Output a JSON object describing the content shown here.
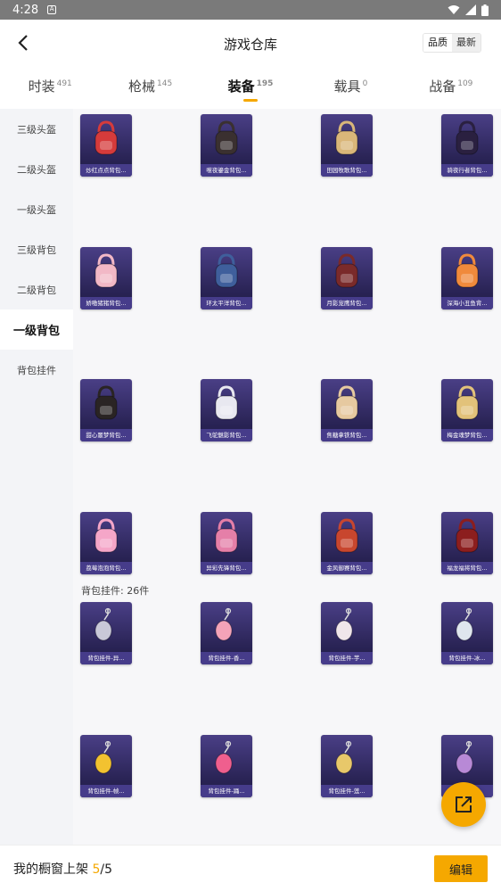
{
  "status_bar": {
    "time": "4:28",
    "notif_glyph": "A"
  },
  "header": {
    "title": "游戏仓库",
    "sort_options": [
      "品质",
      "最新"
    ]
  },
  "tabs": [
    {
      "label": "时装",
      "count": "491"
    },
    {
      "label": "枪械",
      "count": "145"
    },
    {
      "label": "装备",
      "count": "195"
    },
    {
      "label": "载具",
      "count": "0"
    },
    {
      "label": "战备",
      "count": "109"
    }
  ],
  "sidebar": [
    "三级头盔",
    "二级头盔",
    "一级头盔",
    "三级背包",
    "二级背包",
    "一级背包",
    "背包挂件"
  ],
  "backpacks": [
    {
      "name": "炒红点点背包...",
      "icon": "backpack-red-icon",
      "color": "#d63b3b"
    },
    {
      "name": "噬夜鎏金背包...",
      "icon": "backpack-black-gold-icon",
      "color": "#3a3030"
    },
    {
      "name": "田园牧歌背包...",
      "icon": "backpack-basket-icon",
      "color": "#d9b679"
    },
    {
      "name": "骑夜行者背包...",
      "icon": "backpack-neon-icon",
      "color": "#2a2040"
    },
    {
      "name": "娇嗷猪猪背包...",
      "icon": "backpack-pink-pig-icon",
      "color": "#f2b8c6"
    },
    {
      "name": "环太平洋背包...",
      "icon": "backpack-mech-icon",
      "color": "#3f5f9c"
    },
    {
      "name": "月影宠鹰背包...",
      "icon": "backpack-eagle-icon",
      "color": "#7a2a2a"
    },
    {
      "name": "深海小丑鱼背...",
      "icon": "backpack-clownfish-icon",
      "color": "#f08a3c"
    },
    {
      "name": "甜心噩梦背包...",
      "icon": "backpack-cat-icon",
      "color": "#2a2424"
    },
    {
      "name": "飞鸵魅影背包...",
      "icon": "backpack-white-icon",
      "color": "#e8e8f0"
    },
    {
      "name": "焦糖拿铁背包...",
      "icon": "backpack-latte-icon",
      "color": "#e6c9a0"
    },
    {
      "name": "梅金魂梦背包...",
      "icon": "backpack-bunny-icon",
      "color": "#e2c27a"
    },
    {
      "name": "荔莓泡泡背包...",
      "icon": "backpack-bubble-icon",
      "color": "#f5a6c8"
    },
    {
      "name": "异彩先锋背包...",
      "icon": "backpack-floral-icon",
      "color": "#e57fa8"
    },
    {
      "name": "金风御赛背包...",
      "icon": "backpack-lantern-icon",
      "color": "#c8462e"
    },
    {
      "name": "福龙福将背包...",
      "icon": "backpack-dragon-icon",
      "color": "#8c1e1e"
    }
  ],
  "pendant_section": {
    "title": "背包挂件: 26件"
  },
  "pendants": [
    {
      "name": "背包挂件-异...",
      "icon": "pendant-wing-icon",
      "color": "#c9c9d8"
    },
    {
      "name": "背包挂件-香...",
      "icon": "pendant-flower-icon",
      "color": "#f4a3b8"
    },
    {
      "name": "背包挂件-芋...",
      "icon": "pendant-drop-icon",
      "color": "#f0e6ea"
    },
    {
      "name": "背包挂件-冰...",
      "icon": "pendant-robot-icon",
      "color": "#dfe6ee"
    },
    {
      "name": "背包挂件-帧...",
      "icon": "pendant-yellow-icon",
      "color": "#f2c230"
    },
    {
      "name": "背包挂件-踊...",
      "icon": "pendant-heart-icon",
      "color": "#ef5f8e"
    },
    {
      "name": "背包挂件-莲...",
      "icon": "pendant-tassel-icon",
      "color": "#e8c86a"
    },
    {
      "name": "背包挂件-...",
      "icon": "pendant-tag-icon",
      "color": "#b889d6"
    }
  ],
  "bottom": {
    "label": "我的橱窗上架",
    "current": "5",
    "sep": "/",
    "total": "5",
    "edit_label": "编辑"
  },
  "colors": {
    "accent": "#f5a800",
    "card": "#2a2456"
  }
}
